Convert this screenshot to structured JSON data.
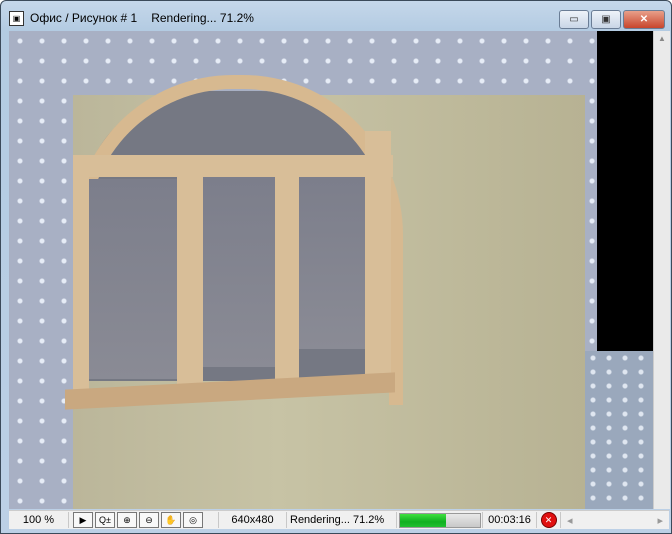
{
  "window": {
    "title": "Офис / Рисунок # 1",
    "title_status": "Rendering... 71.2%",
    "minimize": "▭",
    "maximize": "▣",
    "close": "✕"
  },
  "status": {
    "zoom": "100 %",
    "resolution": "640x480",
    "render_status": "Rendering... 71.2%",
    "progress_fraction": 0.58,
    "elapsed": "00:03:16"
  },
  "colors": {
    "progress": "#10b020",
    "stop": "#e01010"
  }
}
